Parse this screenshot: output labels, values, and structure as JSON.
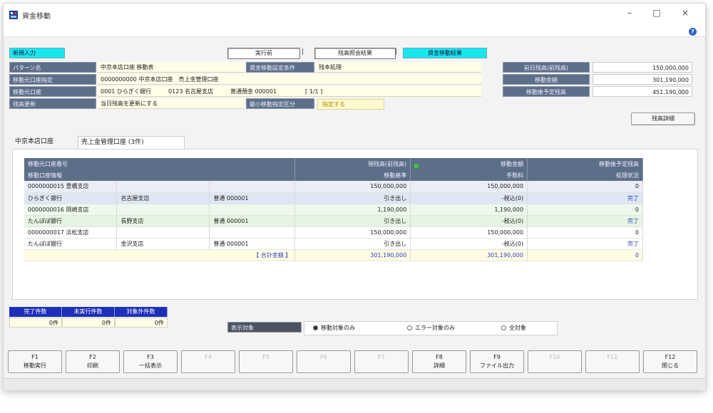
{
  "window": {
    "title": "資金移動",
    "minimize": "–",
    "maximize": "□",
    "close": "×"
  },
  "top": {
    "mode_tag": "新規入力",
    "tab1": "実行前",
    "tab2": "残高照会結果",
    "tab3": "資金移動結果",
    "separator": "|"
  },
  "fields": [
    {
      "label": "パターン名",
      "value": "中京本店口座 移動表"
    },
    {
      "label": "移動元口座指定",
      "value": "0000000000 中京本店口座　売上金管理口座"
    },
    {
      "label": "移動元口座",
      "value": "0001 ひらぎく銀行　　　0123 名古屋支店　　　普通預金 000001　　　　　[ 1/1 ]"
    },
    {
      "label": "残高更新",
      "value": "当日残高を更新にする"
    }
  ],
  "extra_fields": {
    "label1": "資金移動設定条件",
    "value1": "残本処理",
    "label2": "最小移動指定区分",
    "value2": "指定する"
  },
  "summary": [
    {
      "label": "前日残高(前残高)",
      "value": "150,000,000"
    },
    {
      "label": "移動金額",
      "value": "301,190,000"
    },
    {
      "label": "移動後予定残高",
      "value": "451,190,000"
    }
  ],
  "detail_button": "残高詳細",
  "tabs": {
    "main": "中京本店口座",
    "active": "売上金管理口座 (3件)"
  },
  "table": {
    "headers1": [
      "移動元口座番号",
      "現残高(前残高)",
      "移動金額",
      "移動後予定残高"
    ],
    "headers2": [
      "移動口座情報",
      "移動基準",
      "手数料",
      "処理状況"
    ],
    "rows": [
      {
        "c1": "0000000015 豊橋支店",
        "c2": "",
        "c3": "",
        "c4": "150,000,000",
        "c5": "150,000,000",
        "c6": "0",
        "cls": "row-a"
      },
      {
        "c1": "ひらぎく銀行",
        "c2": "名古屋支店",
        "c3": "普通 000001",
        "c4": "引き出し",
        "c5": "-税込(0)",
        "c6": "完了",
        "cls": "row-b"
      },
      {
        "c1": "0000000016 岡崎支店",
        "c2": "",
        "c3": "",
        "c4": "1,190,000",
        "c5": "1,190,000",
        "c6": "0",
        "cls": "row-c"
      },
      {
        "c1": "たんぽぽ銀行",
        "c2": "長野支店",
        "c3": "普通 000001",
        "c4": "引き出し",
        "c5": "-税込(0)",
        "c6": "完了",
        "cls": "row-d"
      },
      {
        "c1": "0000000017 浜松支店",
        "c2": "",
        "c3": "",
        "c4": "150,000,000",
        "c5": "150,000,000",
        "c6": "0",
        "cls": "row-e"
      },
      {
        "c1": "たんぽぽ銀行",
        "c2": "金沢支店",
        "c3": "普通 000001",
        "c4": "引き出し",
        "c5": "-税込(0)",
        "c6": "完了",
        "cls": "row-e"
      }
    ],
    "total": {
      "label": "【 合計金額 】",
      "c4": "301,190,000",
      "c5": "301,190,000",
      "c6": "0"
    }
  },
  "status": {
    "headers": [
      "完了件数",
      "未実行件数",
      "対象外件数"
    ],
    "values": [
      "0件",
      "0件",
      "0件"
    ]
  },
  "display": {
    "label": "表示対象",
    "options": [
      "移動対象のみ",
      "エラー対象のみ",
      "全対象"
    ],
    "selected": 0
  },
  "fkeys": [
    {
      "key": "F1",
      "label": "移動実行",
      "enabled": true
    },
    {
      "key": "F2",
      "label": "印刷",
      "enabled": true
    },
    {
      "key": "F3",
      "label": "一括表示",
      "enabled": true
    },
    {
      "key": "F4",
      "label": "",
      "enabled": false
    },
    {
      "key": "F5",
      "label": "",
      "enabled": false
    },
    {
      "key": "F6",
      "label": "",
      "enabled": false
    },
    {
      "key": "F7",
      "label": "",
      "enabled": false
    },
    {
      "key": "F8",
      "label": "詳細",
      "enabled": true
    },
    {
      "key": "F9",
      "label": "ファイル出力",
      "enabled": true
    },
    {
      "key": "F10",
      "label": "",
      "enabled": false
    },
    {
      "key": "F11",
      "label": "",
      "enabled": false
    },
    {
      "key": "F12",
      "label": "閉じる",
      "enabled": true
    }
  ]
}
